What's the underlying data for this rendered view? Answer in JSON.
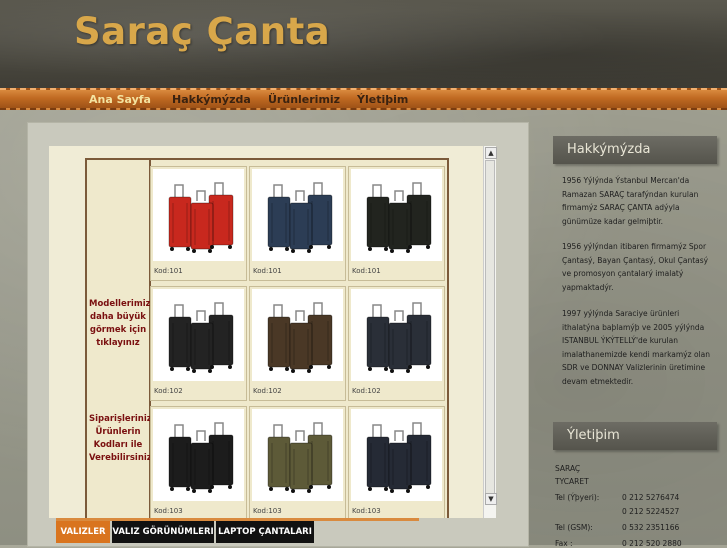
{
  "site": {
    "title": "Saraç Çanta"
  },
  "nav": [
    {
      "label": "Ana Sayfa",
      "active": true
    },
    {
      "label": "Hakkýmýzda"
    },
    {
      "label": "Ürünlerimiz"
    },
    {
      "label": "Ýletiþim"
    }
  ],
  "products": {
    "left_text_1": "Modellerimizi daha büyük görmek için tıklayınız",
    "left_text_2": "Siparişlerinizi Ürünlerin Kodları ile Verebilirsiniz",
    "rows": [
      {
        "cells": [
          {
            "code": "Kod:101",
            "color": "#c8281e",
            "icon": "suitcase-set-red"
          },
          {
            "code": "Kod:101",
            "color": "#2c3d55",
            "icon": "suitcase-set-navy"
          },
          {
            "code": "Kod:101",
            "color": "#22241f",
            "icon": "suitcase-set-black"
          }
        ]
      },
      {
        "cells": [
          {
            "code": "Kod:102",
            "color": "#232323",
            "icon": "suitcase-set-black"
          },
          {
            "code": "Kod:102",
            "color": "#4a3826",
            "icon": "suitcase-set-brown"
          },
          {
            "code": "Kod:102",
            "color": "#2a2f38",
            "icon": "suitcase-set-darkgray"
          }
        ]
      },
      {
        "cells": [
          {
            "code": "Kod:103",
            "color": "#1c1c1c",
            "icon": "suitcase-set-black"
          },
          {
            "code": "Kod:103",
            "color": "#5d5a38",
            "icon": "suitcase-set-olive"
          },
          {
            "code": "Kod:103",
            "color": "#252a35",
            "icon": "suitcase-set-navy"
          }
        ]
      }
    ]
  },
  "tabs": [
    {
      "label": "VALIZLER",
      "active": true
    },
    {
      "label": "VALIZ GÖRÜNÜMLERI"
    },
    {
      "label": "LAPTOP ÇANTALARI"
    }
  ],
  "sidebar": {
    "about_heading": "Hakkýmýzda",
    "about_p1": "1956 Yýlýnda Ýstanbul Mercan'da Ramazan SARAÇ tarafýndan kurulan firmamýz SARAÇ ÇANTA adýyla günümüze kadar gelmiþtir.",
    "about_p2": "1956 yýlýndan itibaren firmamýz Spor Çantasý, Bayan Çantasý, Okul Çantasý ve promosyon çantalarý imalatý yapmaktadýr.",
    "about_p3": "1997 yýlýnda Saraciye ürünleri ithalatýna baþlamýþ ve 2005 yýlýnda ISTANBUL ÝKÝTELLÝ'de kurulan imalathanemizde kendi markamýz olan SDR ve DONNAY Valizlerinin üretimine devam etmektedir.",
    "contact_heading": "Ýletiþim",
    "company": "SARAÇ TYCARET",
    "contacts": [
      {
        "label": "Tel (Ýþyeri):",
        "value": "0 212 5276474"
      },
      {
        "label": "",
        "value": "0 212 5224527"
      },
      {
        "label": "Tel (GSM):",
        "value": "0 532 2351166"
      },
      {
        "label": "Fax :",
        "value": "0 212 520 2880"
      }
    ]
  }
}
